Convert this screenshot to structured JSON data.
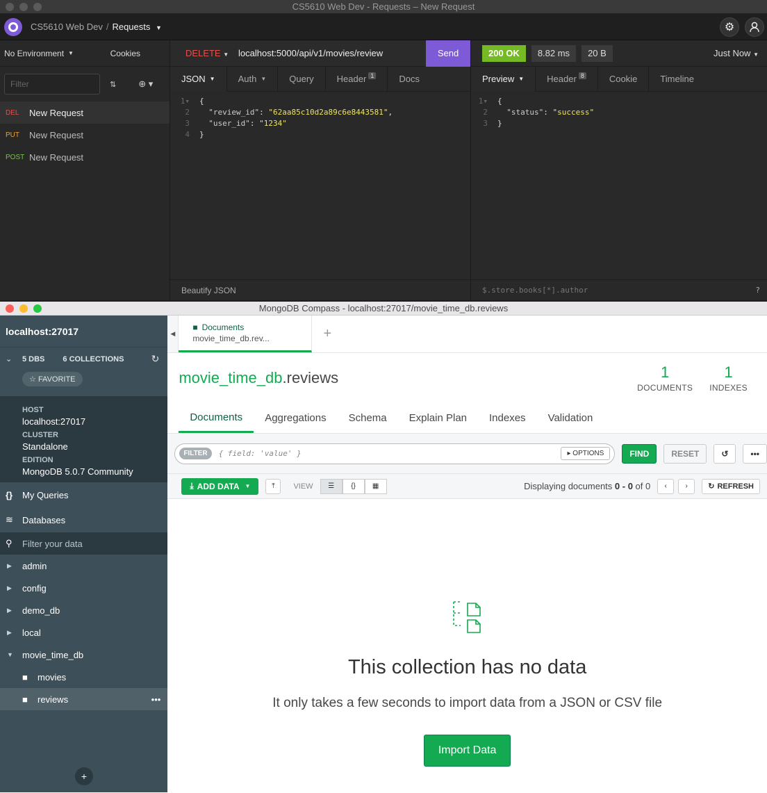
{
  "insomnia": {
    "window_title": "CS5610 Web Dev - Requests – New Request",
    "workspace": "CS5610 Web Dev",
    "workspace_sep": "/",
    "workspace_current": "Requests",
    "environment": "No Environment",
    "cookies": "Cookies",
    "filter_placeholder": "Filter",
    "requests": [
      {
        "method": "DEL",
        "name": "New Request"
      },
      {
        "method": "PUT",
        "name": "New Request"
      },
      {
        "method": "POST",
        "name": "New Request"
      }
    ],
    "method": "DELETE",
    "url": "localhost:5000/api/v1/movies/review",
    "send": "Send",
    "request_tabs": {
      "json": "JSON",
      "auth": "Auth",
      "query": "Query",
      "header": "Header",
      "header_count": "1",
      "docs": "Docs"
    },
    "request_body": {
      "l1": "{",
      "k1": "\"review_id\"",
      "v1": "\"62aa85c10d2a89c6e8443581\"",
      "k2": "\"user_id\"",
      "v2": "\"1234\"",
      "l4": "}"
    },
    "beautify": "Beautify JSON",
    "status": "200 OK",
    "time": "8.82 ms",
    "size": "20 B",
    "when": "Just Now",
    "response_tabs": {
      "preview": "Preview",
      "header": "Header",
      "header_count": "8",
      "cookie": "Cookie",
      "timeline": "Timeline"
    },
    "response_body": {
      "l1": "{",
      "k1": "\"status\"",
      "v1": "\"success\"",
      "l3": "}"
    },
    "jsonpath_placeholder": "$.store.books[*].author"
  },
  "compass": {
    "window_title": "MongoDB Compass - localhost:27017/movie_time_db.reviews",
    "host_title": "localhost:27017",
    "dbs": "5 DBS",
    "collections": "6 COLLECTIONS",
    "favorite": "FAVORITE",
    "info": [
      {
        "label": "HOST",
        "value": "localhost:27017"
      },
      {
        "label": "CLUSTER",
        "value": "Standalone"
      },
      {
        "label": "EDITION",
        "value": "MongoDB 5.0.7 Community"
      }
    ],
    "my_queries": "My Queries",
    "databases": "Databases",
    "filter_data": "Filter your data",
    "db_list": [
      "admin",
      "config",
      "demo_db",
      "local",
      "movie_time_db"
    ],
    "collections_list": [
      "movies",
      "reviews"
    ],
    "tab_title": "Documents",
    "tab_sub": "movie_time_db.rev...",
    "ns_db": "movie_time_db",
    "ns_coll": ".reviews",
    "documents_count": "1",
    "documents_label": "DOCUMENTS",
    "indexes_count": "1",
    "indexes_label": "INDEXES",
    "subtabs": [
      "Documents",
      "Aggregations",
      "Schema",
      "Explain Plan",
      "Indexes",
      "Validation"
    ],
    "filter_tag": "FILTER",
    "filter_placeholder": "{ field: 'value' }",
    "options": "OPTIONS",
    "find": "FIND",
    "reset": "RESET",
    "add_data": "ADD DATA",
    "view": "VIEW",
    "displaying_prefix": "Displaying documents ",
    "displaying_range": "0 - 0",
    "displaying_of": " of 0",
    "refresh": "REFRESH",
    "empty_title": "This collection has no data",
    "empty_sub": "It only takes a few seconds to import data from a JSON or CSV file",
    "import": "Import Data"
  }
}
